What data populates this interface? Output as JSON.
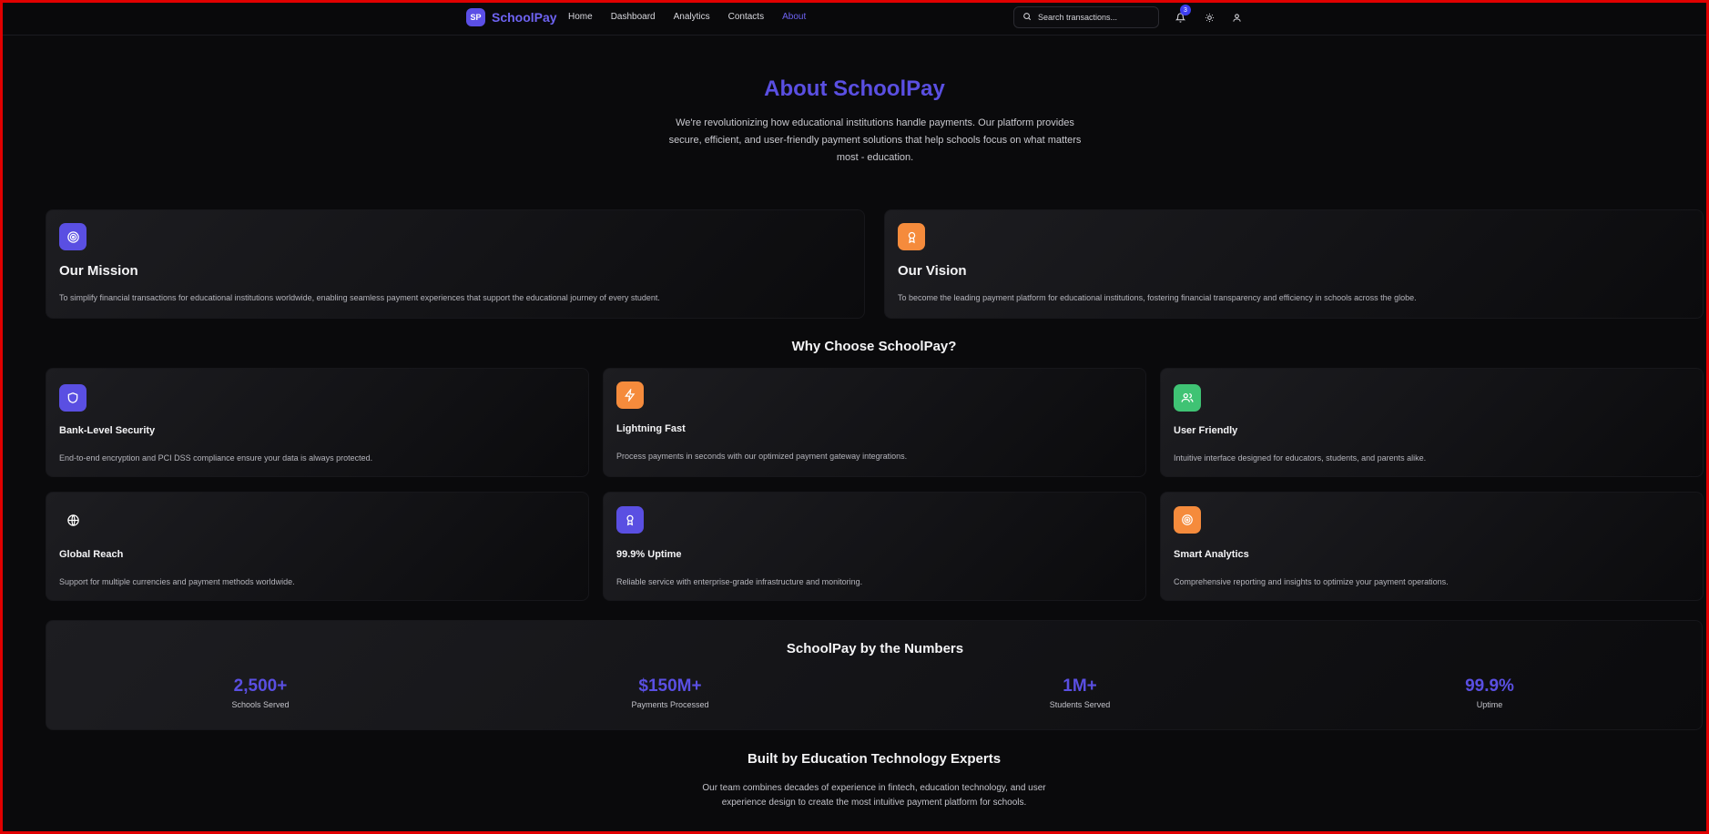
{
  "nav": {
    "logo_badge": "SP",
    "logo_text": "SchoolPay",
    "links": [
      "Home",
      "Dashboard",
      "Analytics",
      "Contacts",
      "About"
    ],
    "active_link": "About",
    "search_placeholder": "Search transactions...",
    "notification_count": "3",
    "icons": [
      "search-icon",
      "bell-icon",
      "sun-icon",
      "user-icon"
    ]
  },
  "hero": {
    "title": "About SchoolPay",
    "description": "We're revolutionizing how educational institutions handle payments. Our platform provides secure, efficient, and user-friendly payment solutions that help schools focus on what matters most - education."
  },
  "mission": {
    "title": "Our Mission",
    "text": "To simplify financial transactions for educational institutions worldwide, enabling seamless payment experiences that support the educational journey of every student.",
    "icon": "target-icon"
  },
  "vision": {
    "title": "Our Vision",
    "text": "To become the leading payment platform for educational institutions, fostering financial transparency and efficiency in schools across the globe.",
    "icon": "award-icon"
  },
  "why": {
    "title": "Why Choose SchoolPay?",
    "features": [
      {
        "title": "Bank-Level Security",
        "text": "End-to-end encryption and PCI DSS compliance ensure your data is always protected.",
        "icon": "shield-icon",
        "color": "#5a4fe2"
      },
      {
        "title": "Lightning Fast",
        "text": "Process payments in seconds with our optimized payment gateway integrations.",
        "icon": "lightning-icon",
        "color": "#f58b3c"
      },
      {
        "title": "User Friendly",
        "text": "Intuitive interface designed for educators, students, and parents alike.",
        "icon": "users-icon",
        "color": "#3fc374"
      },
      {
        "title": "Global Reach",
        "text": "Support for multiple currencies and payment methods worldwide.",
        "icon": "globe-icon",
        "color": "transparent"
      },
      {
        "title": "99.9% Uptime",
        "text": "Reliable service with enterprise-grade infrastructure and monitoring.",
        "icon": "award-icon",
        "color": "#5a4fe2"
      },
      {
        "title": "Smart Analytics",
        "text": "Comprehensive reporting and insights to optimize your payment operations.",
        "icon": "target-icon",
        "color": "#f58b3c"
      }
    ]
  },
  "numbers": {
    "title": "SchoolPay by the Numbers",
    "stats": [
      {
        "value": "2,500+",
        "label": "Schools Served"
      },
      {
        "value": "$150M+",
        "label": "Payments Processed"
      },
      {
        "value": "1M+",
        "label": "Students Served"
      },
      {
        "value": "99.9%",
        "label": "Uptime"
      }
    ]
  },
  "team": {
    "title": "Built by Education Technology Experts",
    "text": "Our team combines decades of experience in fintech, education technology, and user experience design to create the most intuitive payment platform for schools."
  },
  "colors": {
    "accent": "#5a4fe2",
    "orange": "#f58b3c",
    "green": "#3fc374",
    "background": "#0a0a0c"
  }
}
